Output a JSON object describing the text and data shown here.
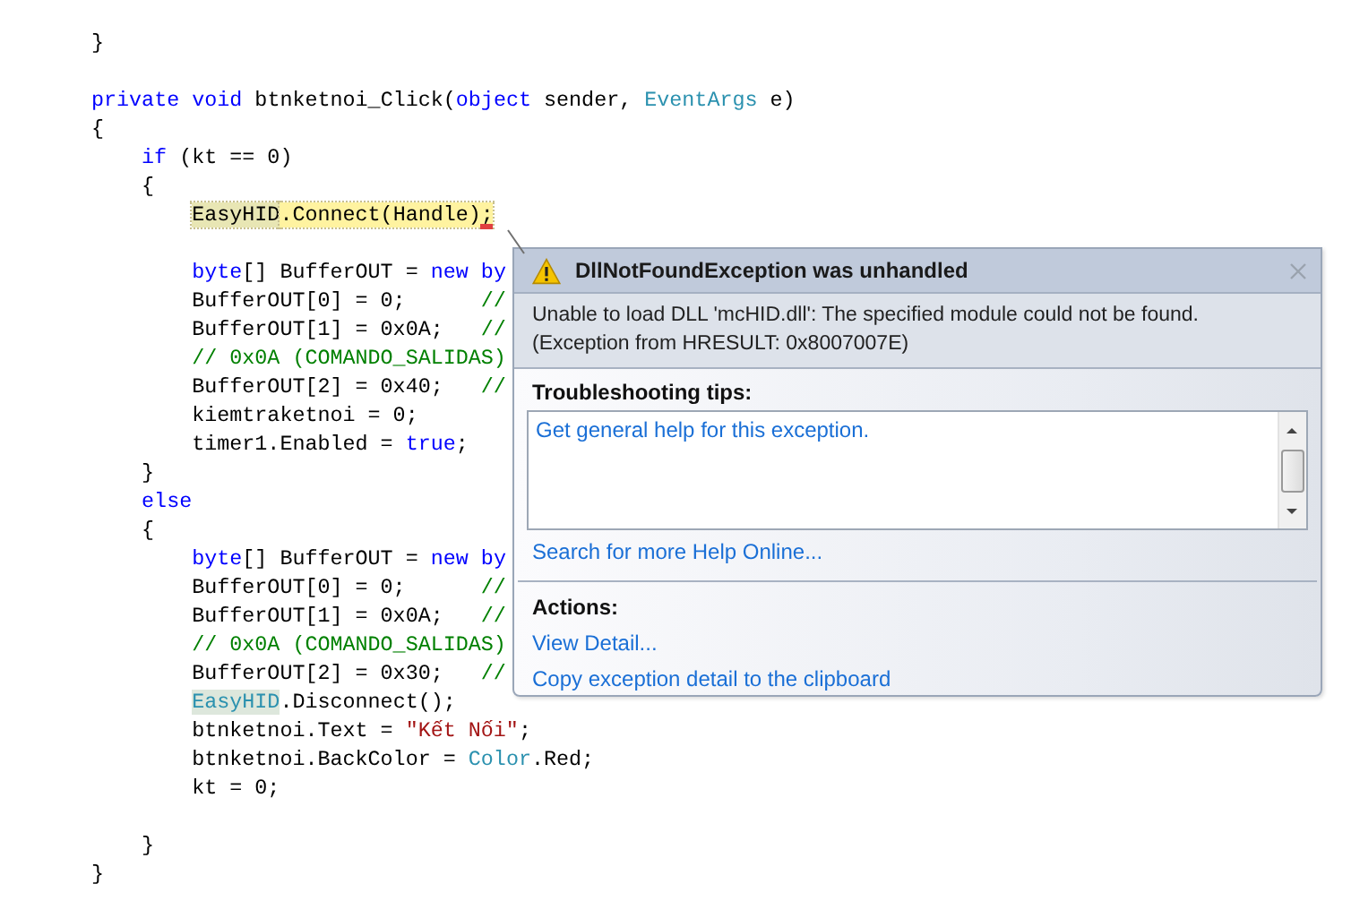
{
  "code_lines": [
    {
      "kind": "code",
      "tokens": [
        {
          "kind": "plain",
          "text": "}"
        }
      ]
    },
    {
      "kind": "blank"
    },
    {
      "kind": "code",
      "tokens": [
        {
          "kind": "keyword",
          "text": "private void"
        },
        {
          "kind": "plain",
          "text": " btnketnoi_Click("
        },
        {
          "kind": "keyword",
          "text": "object"
        },
        {
          "kind": "plain",
          "text": " sender, "
        },
        {
          "kind": "type",
          "text": "EventArgs"
        },
        {
          "kind": "plain",
          "text": " e)"
        }
      ]
    },
    {
      "kind": "code",
      "tokens": [
        {
          "kind": "plain",
          "text": "{"
        }
      ],
      "children": [
        {
          "kind": "code",
          "tokens": [
            {
              "kind": "keyword",
              "text": "if"
            },
            {
              "kind": "plain",
              "text": " (kt == 0)"
            }
          ]
        },
        {
          "kind": "code",
          "tokens": [
            {
              "kind": "plain",
              "text": "{"
            }
          ],
          "children": [
            {
              "kind": "code",
              "tokens": [
                {
                  "kind": "current_head",
                  "text": "EasyHID"
                },
                {
                  "kind": "current",
                  "text": ".Connect(Handle);"
                }
              ]
            },
            {
              "kind": "blank"
            },
            {
              "kind": "code",
              "tokens": [
                {
                  "kind": "keyword",
                  "text": "byte"
                },
                {
                  "kind": "plain",
                  "text": "[] BufferOUT = "
                },
                {
                  "kind": "keyword",
                  "text": "new by"
                }
              ]
            },
            {
              "kind": "code",
              "tokens": [
                {
                  "kind": "plain",
                  "text": "BufferOUT[0] = 0;      "
                },
                {
                  "kind": "comment",
                  "text": "//"
                }
              ]
            },
            {
              "kind": "code",
              "tokens": [
                {
                  "kind": "plain",
                  "text": "BufferOUT[1] = 0x0A;   "
                },
                {
                  "kind": "comment",
                  "text": "//"
                }
              ]
            },
            {
              "kind": "code",
              "tokens": [
                {
                  "kind": "comment",
                  "text": "// 0x0A (COMANDO_SALIDAS)"
                }
              ]
            },
            {
              "kind": "code",
              "tokens": [
                {
                  "kind": "plain",
                  "text": "BufferOUT[2] = 0x40;   "
                },
                {
                  "kind": "comment",
                  "text": "//"
                }
              ]
            },
            {
              "kind": "code",
              "tokens": [
                {
                  "kind": "plain",
                  "text": "kiemtraketnoi = 0;"
                }
              ]
            },
            {
              "kind": "code",
              "tokens": [
                {
                  "kind": "plain",
                  "text": "timer1.Enabled = "
                },
                {
                  "kind": "keyword",
                  "text": "true"
                },
                {
                  "kind": "plain",
                  "text": ";"
                }
              ]
            }
          ]
        },
        {
          "kind": "code",
          "tokens": [
            {
              "kind": "plain",
              "text": "}"
            }
          ]
        },
        {
          "kind": "code",
          "tokens": [
            {
              "kind": "keyword",
              "text": "else"
            }
          ]
        },
        {
          "kind": "code",
          "tokens": [
            {
              "kind": "plain",
              "text": "{"
            }
          ],
          "children": [
            {
              "kind": "code",
              "tokens": [
                {
                  "kind": "keyword",
                  "text": "byte"
                },
                {
                  "kind": "plain",
                  "text": "[] BufferOUT = "
                },
                {
                  "kind": "keyword",
                  "text": "new by"
                }
              ]
            },
            {
              "kind": "code",
              "tokens": [
                {
                  "kind": "plain",
                  "text": "BufferOUT[0] = 0;      "
                },
                {
                  "kind": "comment",
                  "text": "//"
                }
              ]
            },
            {
              "kind": "code",
              "tokens": [
                {
                  "kind": "plain",
                  "text": "BufferOUT[1] = 0x0A;   "
                },
                {
                  "kind": "comment",
                  "text": "//"
                }
              ]
            },
            {
              "kind": "code",
              "tokens": [
                {
                  "kind": "comment",
                  "text": "// 0x0A (COMANDO_SALIDAS)"
                }
              ]
            },
            {
              "kind": "code",
              "tokens": [
                {
                  "kind": "plain",
                  "text": "BufferOUT[2] = 0x30;   "
                },
                {
                  "kind": "comment",
                  "text": "//"
                }
              ]
            },
            {
              "kind": "code",
              "tokens": [
                {
                  "kind": "reference",
                  "text": "EasyHID"
                },
                {
                  "kind": "plain",
                  "text": ".Disconnect();"
                }
              ]
            },
            {
              "kind": "code",
              "tokens": [
                {
                  "kind": "plain",
                  "text": "btnketnoi.Text = "
                },
                {
                  "kind": "string",
                  "text": "\"Kết Nối\""
                },
                {
                  "kind": "plain",
                  "text": ";"
                }
              ]
            },
            {
              "kind": "code",
              "tokens": [
                {
                  "kind": "plain",
                  "text": "btnketnoi.BackColor = "
                },
                {
                  "kind": "type",
                  "text": "Color"
                },
                {
                  "kind": "plain",
                  "text": ".Red;"
                }
              ]
            },
            {
              "kind": "code",
              "tokens": [
                {
                  "kind": "plain",
                  "text": "kt = 0;"
                }
              ]
            },
            {
              "kind": "blank"
            }
          ]
        },
        {
          "kind": "code",
          "tokens": [
            {
              "kind": "plain",
              "text": "}"
            }
          ]
        }
      ]
    },
    {
      "kind": "code",
      "tokens": [
        {
          "kind": "plain",
          "text": "}"
        }
      ]
    }
  ],
  "exception_popup": {
    "title": "DllNotFoundException was unhandled",
    "message_lines": [
      "Unable to load DLL 'mcHID.dll': The specified module could not be found.",
      "(Exception from HRESULT: 0x8007007E)"
    ],
    "tips_heading": "Troubleshooting tips:",
    "tips": [
      "Get general help for this exception."
    ],
    "help_link": "Search for more Help Online...",
    "actions_heading": "Actions:",
    "actions": [
      "View Detail...",
      "Copy exception detail to the clipboard"
    ]
  }
}
